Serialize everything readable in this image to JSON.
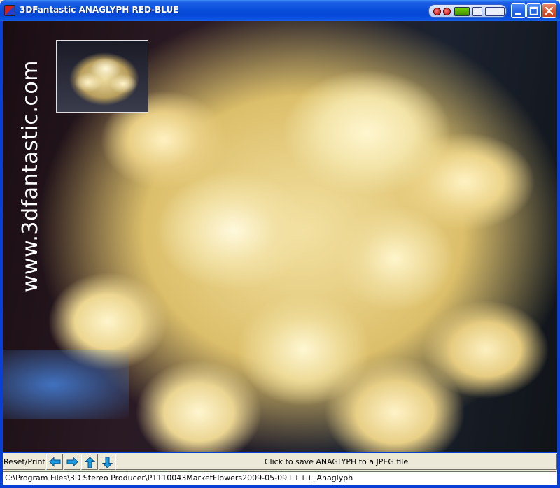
{
  "window": {
    "title": "3DFantastic ANAGLYPH RED-BLUE",
    "icon": "anaglyph-app-icon"
  },
  "viewport": {
    "watermark": "www.3dfantastic.com"
  },
  "toolbar": {
    "reset_print_label": "Reset/Print",
    "save_label": "Click to save ANAGLYPH to a JPEG file",
    "arrow_color": "#1c9adf"
  },
  "status": {
    "path": "C:\\Program Files\\3D Stereo Producer\\P1110043MarketFlowers2009-05-09++++_Anaglyph"
  }
}
